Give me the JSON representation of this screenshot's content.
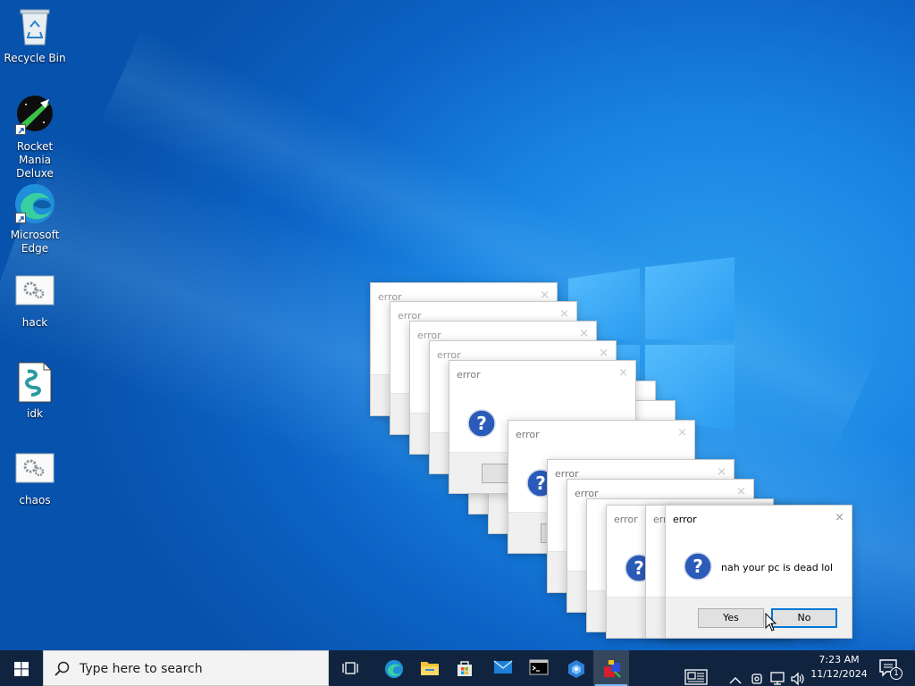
{
  "desktop_icons": [
    {
      "label": "Recycle Bin",
      "icon": "recycle-bin-icon"
    },
    {
      "label": "Rocket Mania Deluxe",
      "icon": "rocket-mania-icon"
    },
    {
      "label": "Microsoft Edge",
      "icon": "edge-icon"
    },
    {
      "label": "hack",
      "icon": "settings-file-icon"
    },
    {
      "label": "idk",
      "icon": "script-file-icon"
    },
    {
      "label": "chaos",
      "icon": "settings-file-icon"
    }
  ],
  "dialog": {
    "title": "error",
    "close": "×",
    "message": "nah your pc is dead lol",
    "yes_label": "Yes",
    "no_label": "No"
  },
  "taskbar": {
    "search_placeholder": "Type here to search",
    "apps": [
      "task-view",
      "microsoft-edge",
      "file-explorer",
      "microsoft-store",
      "mail",
      "command-prompt",
      "app",
      "app-active"
    ],
    "time": "7:23 AM",
    "date": "11/12/2024",
    "notification_count": "1"
  },
  "colors": {
    "taskbar": "#10243f",
    "desktop_accent": "#1a86e4",
    "focus_blue": "#0078d7"
  }
}
